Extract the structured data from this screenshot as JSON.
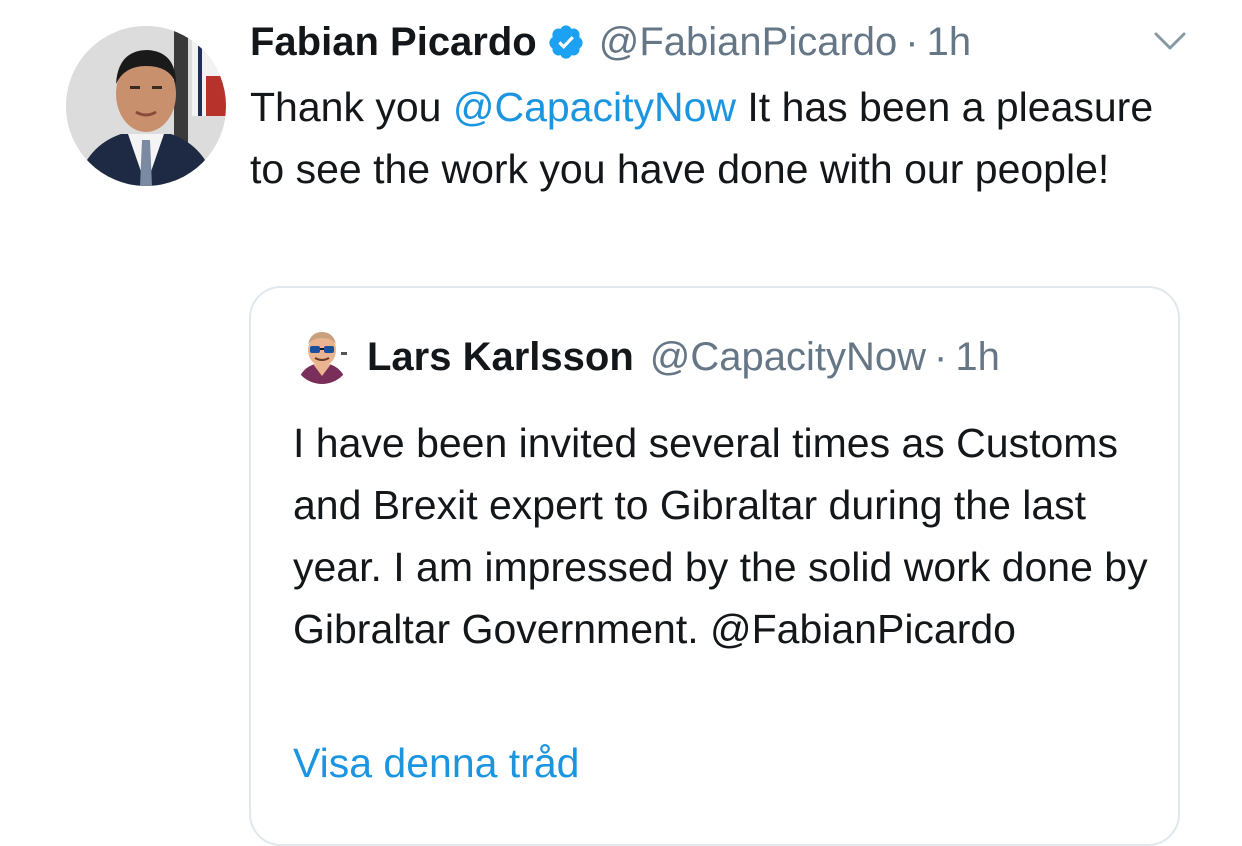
{
  "tweet": {
    "author_name": "Fabian Picardo",
    "handle": "@FabianPicardo",
    "separator": "·",
    "time": "1h",
    "text_before": "Thank you ",
    "mention": "@CapacityNow",
    "text_after": " It has been a pleasure to see the work you have done with our people!",
    "icons": {
      "verified": "verified-badge-icon",
      "menu": "chevron-down-icon"
    },
    "colors": {
      "link": "#1b95e0",
      "muted": "#657786",
      "text": "#14171a",
      "border": "#e1e8ed"
    }
  },
  "quoted_tweet": {
    "author_name": "Lars Karlsson",
    "handle": "@CapacityNow",
    "separator": "·",
    "time": "1h",
    "text": "I have been invited several times as Customs and Brexit expert to Gibraltar during the last year. I am impressed by the solid work done by Gibraltar Government. @FabianPicardo",
    "show_thread_label": "Visa denna tråd"
  }
}
